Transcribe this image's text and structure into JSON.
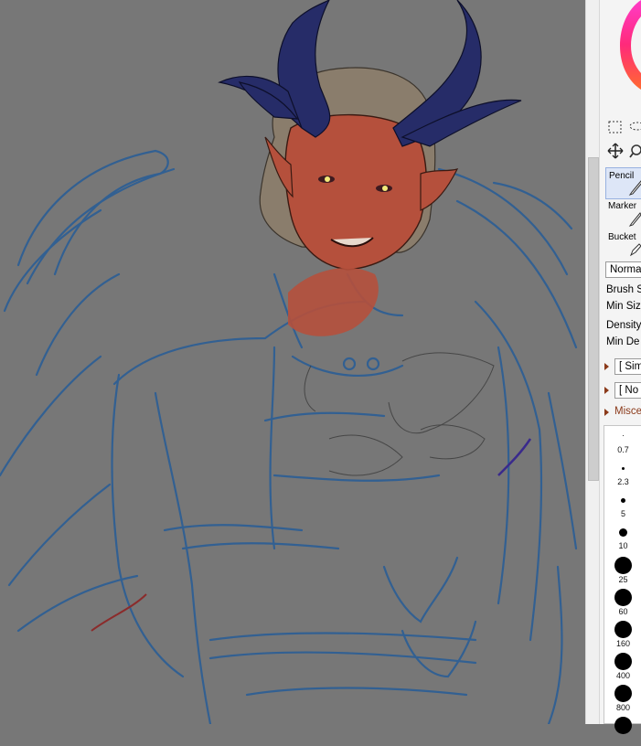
{
  "tools": {
    "select_rect_icon": "rect-select-icon",
    "lasso_icon": "lasso-icon",
    "move_icon": "move-icon",
    "zoom_icon": "zoom-icon"
  },
  "brushes": [
    {
      "label": "Pencil",
      "selected": true
    },
    {
      "label": "Marker",
      "selected": false
    },
    {
      "label": "Bucket",
      "selected": false
    }
  ],
  "blend_mode": "Normal",
  "brush_props": {
    "brush_size": "Brush S",
    "min_size": "Min Size",
    "density": "Density",
    "min_density": "Min De"
  },
  "shape_dropdowns": {
    "first": "[ Sim",
    "second": "[ No"
  },
  "misc_header": "Misce",
  "brush_sizes": [
    "0.7",
    "2.3",
    "5",
    "10",
    "25",
    "60",
    "160",
    "400",
    "800"
  ],
  "colors": {
    "canvas_bg": "#777777",
    "sketch_blue": "#2f5f94",
    "skin": "#b5503c",
    "horn": "#262c68"
  }
}
